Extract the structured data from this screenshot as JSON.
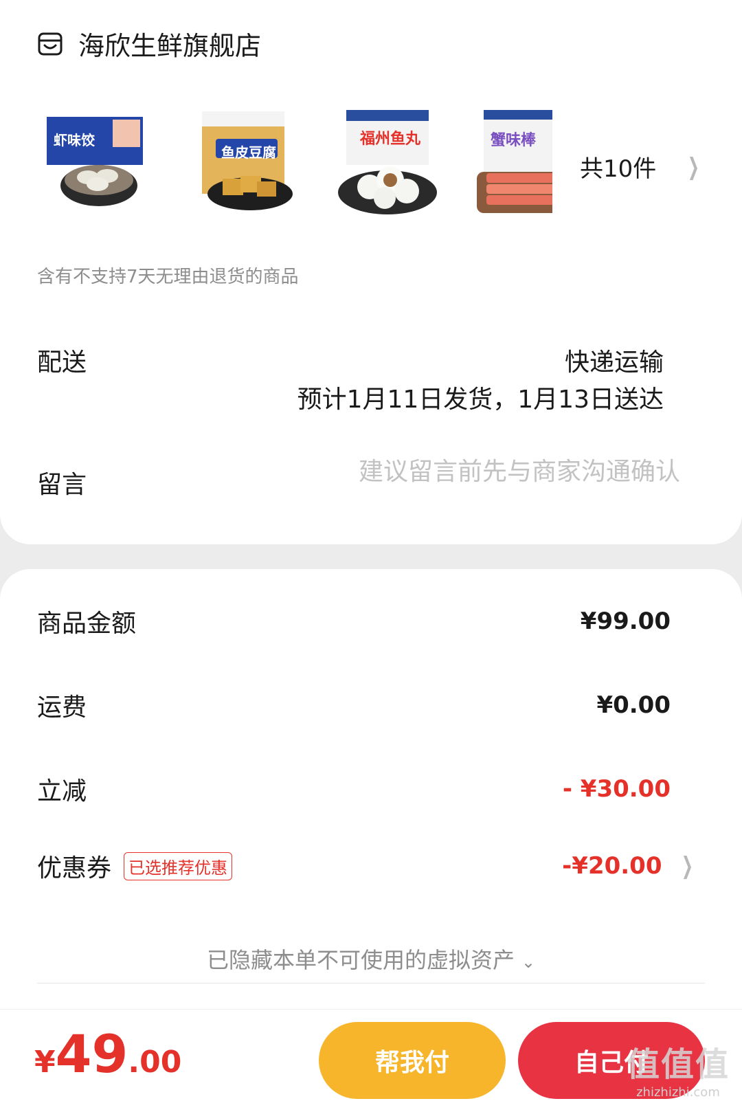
{
  "shop": {
    "name": "海欣生鲜旗舰店",
    "icon": "store-icon"
  },
  "products": {
    "thumbnails": [
      {
        "name": "虾味饺",
        "label_color": "#ffffff",
        "bg": "#2446a8"
      },
      {
        "name": "鱼皮豆腐",
        "label_color": "#ffffff",
        "bg": "#d9a13a"
      },
      {
        "name": "福州鱼丸",
        "label_color": "#e4322b",
        "bg": "#f3f3f3"
      },
      {
        "name": "蟹味棒",
        "label_color": "#ffffff",
        "bg": "#e8715e"
      }
    ],
    "count_text": "共10件",
    "return_note": "含有不支持7天无理由退货的商品"
  },
  "shipping": {
    "label": "配送",
    "method": "快递运输",
    "eta": "预计1月11日发货，1月13日送达"
  },
  "message": {
    "label": "留言",
    "placeholder": "建议留言前先与商家沟通确认"
  },
  "price": {
    "subtotal_label": "商品金额",
    "subtotal_value": "¥99.00",
    "freight_label": "运费",
    "freight_value": "¥0.00",
    "discount_label": "立减",
    "discount_value": "- ¥30.00",
    "coupon_label": "优惠券",
    "coupon_badge": "已选推荐优惠",
    "coupon_value": "-¥20.00",
    "hidden_assets_text": "已隐藏本单不可使用的虚拟资产",
    "accent_color": "#e4322b"
  },
  "footer": {
    "total_currency": "¥",
    "total_int": "49",
    "total_dec": ".00",
    "help_pay_label": "帮我付",
    "self_pay_label": "自己付",
    "help_color": "#f6b52a",
    "self_color": "#e83343"
  },
  "watermark": {
    "glyphs": "值值值",
    "site": "zhizhizhi.com"
  }
}
